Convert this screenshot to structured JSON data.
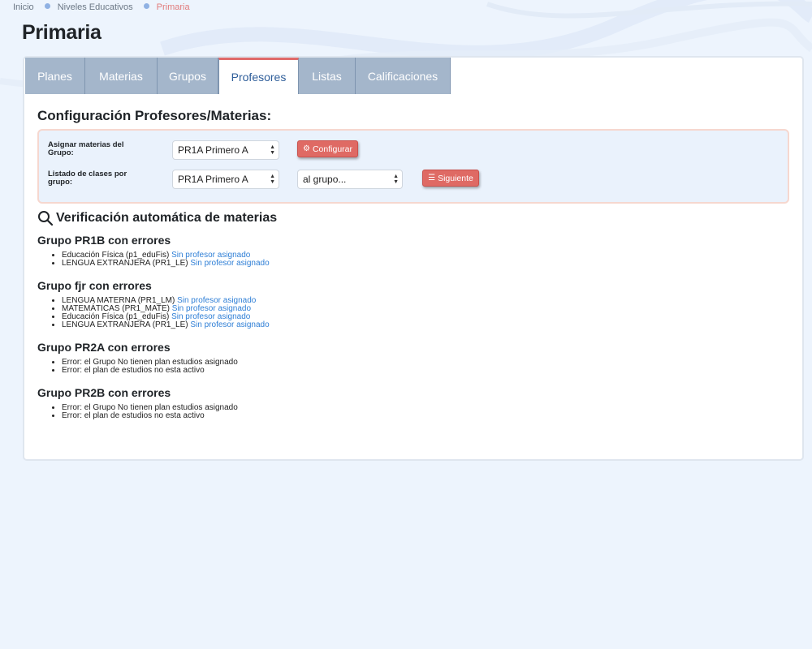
{
  "breadcrumb": {
    "items": [
      "Inicio",
      "Niveles Educativos"
    ],
    "current": "Primaria"
  },
  "page_title": "Primaria",
  "tabs": [
    {
      "label": "Planes"
    },
    {
      "label": "Materias"
    },
    {
      "label": "Grupos"
    },
    {
      "label": "Profesores",
      "active": true
    },
    {
      "label": "Listas"
    },
    {
      "label": "Calificaciones"
    }
  ],
  "config": {
    "title": "Configuración Profesores/Materias:",
    "row1": {
      "label": "Asignar materias del Grupo:",
      "select_value": "PR1A Primero A",
      "button": "Configurar"
    },
    "row2": {
      "label": "Listado de clases por grupo:",
      "select_value": "PR1A Primero A",
      "select2_value": "al grupo...",
      "button": "Siguiente"
    }
  },
  "verification": {
    "title": "Verificación automática de materias",
    "groups": [
      {
        "title": "Grupo PR1B con errores",
        "items": [
          {
            "text": "Educación Física (p1_eduFis)",
            "link": "Sin profesor asignado"
          },
          {
            "text": "LENGUA EXTRANJERA (PR1_LE)",
            "link": "Sin profesor asignado"
          }
        ]
      },
      {
        "title": "Grupo fjr con errores",
        "items": [
          {
            "text": "LENGUA MATERNA (PR1_LM)",
            "link": "Sin profesor asignado"
          },
          {
            "text": "MATEMÁTICAS (PR1_MATE)",
            "link": "Sin profesor asignado"
          },
          {
            "text": "Educación Física (p1_eduFis)",
            "link": "Sin profesor asignado"
          },
          {
            "text": "LENGUA EXTRANJERA (PR1_LE)",
            "link": "Sin profesor asignado"
          }
        ]
      },
      {
        "title": "Grupo PR2A con errores",
        "items": [
          {
            "text": "Error: el Grupo No tienen plan estudios asignado"
          },
          {
            "text": "Error: el plan de estudios no esta activo"
          }
        ]
      },
      {
        "title": "Grupo PR2B con errores",
        "items": [
          {
            "text": "Error: el Grupo No tienen plan estudios asignado"
          },
          {
            "text": "Error: el plan de estudios no esta activo"
          }
        ]
      }
    ]
  },
  "colors": {
    "accent_red": "#df6a64",
    "tab_bg": "#a4b6cb",
    "link": "#2f7fd6",
    "page_bg": "#edf4fd"
  },
  "icons": {
    "configure": "gear-icon",
    "next": "list-icon",
    "verify": "search-icon"
  }
}
